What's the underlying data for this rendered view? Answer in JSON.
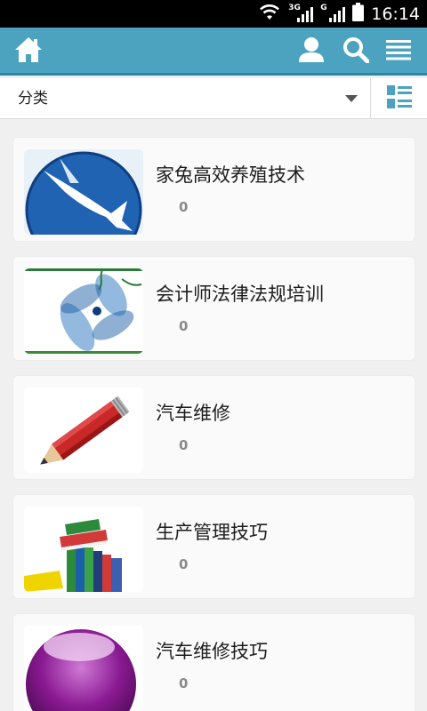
{
  "status_bar": {
    "time": "16:14",
    "network_1": "3G",
    "network_2": "G",
    "icons": [
      "wifi-icon",
      "signal-icon",
      "signal-icon",
      "battery-icon"
    ]
  },
  "app_bar": {
    "background": "#4ba3bf",
    "icons": [
      "home-icon",
      "user-icon",
      "search-icon",
      "menu-icon"
    ]
  },
  "filter": {
    "category_label": "分类",
    "view_toggle_icon": "list-view-icon"
  },
  "items": [
    {
      "title": "家兔高效养殖技术",
      "count": "0",
      "thumbnail": "swordfish-logo"
    },
    {
      "title": "会计师法律法规培训",
      "count": "0",
      "thumbnail": "blue-flower"
    },
    {
      "title": "汽车维修",
      "count": "0",
      "thumbnail": "red-pencil"
    },
    {
      "title": "生产管理技巧",
      "count": "0",
      "thumbnail": "book-stack"
    },
    {
      "title": "汽车维修技巧",
      "count": "0",
      "thumbnail": "purple-orb"
    }
  ]
}
